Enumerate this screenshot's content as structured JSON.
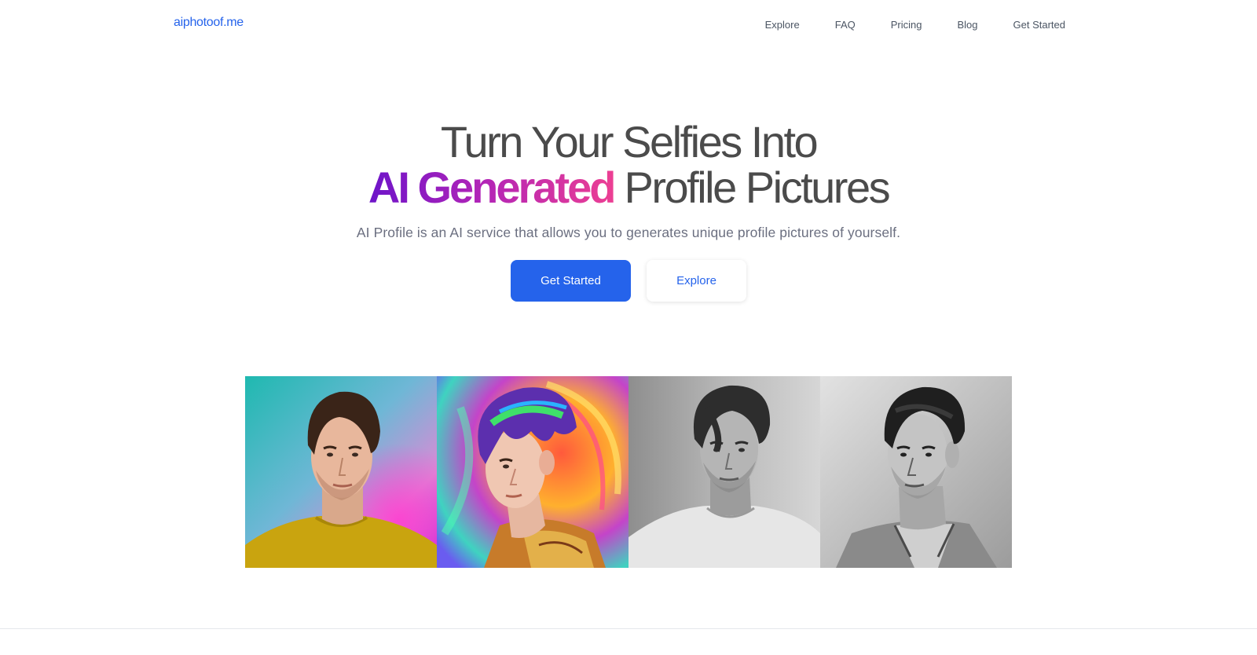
{
  "header": {
    "logo": "aiphotoof.me",
    "nav": [
      {
        "label": "Explore"
      },
      {
        "label": "FAQ"
      },
      {
        "label": "Pricing"
      },
      {
        "label": "Blog"
      },
      {
        "label": "Get Started"
      }
    ]
  },
  "hero": {
    "title_line1": "Turn Your Selfies Into",
    "title_accent": "AI Generated",
    "title_rest": "Profile Pictures",
    "subtitle": "AI Profile is an AI service that allows you to generates unique profile pictures of yourself.",
    "primary_button": "Get Started",
    "secondary_button": "Explore"
  },
  "colors": {
    "accent": "#2563eb",
    "gradient_start": "#6d14c9",
    "gradient_end": "#ec3f93",
    "text_dark": "#4b4b4b",
    "text_muted": "#6b6f80"
  }
}
